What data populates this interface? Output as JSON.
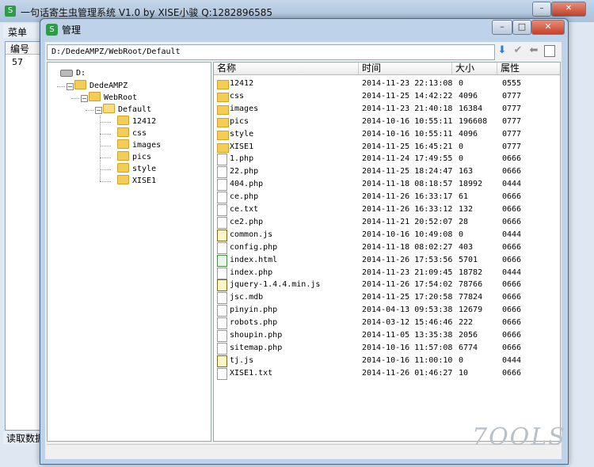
{
  "background_window": {
    "title": "一句话寄生虫管理系统 V1.0 by XISE小骏 Q:1282896585",
    "menu": "菜单",
    "list_header": "编号",
    "list_value": "57",
    "status": "读取数据"
  },
  "window": {
    "title": "管理",
    "min": "–",
    "max": "□",
    "close": "✕"
  },
  "toolbar": {
    "path": "D:/DedeAMPZ/WebRoot/Default",
    "icons": [
      "download-arrow-icon",
      "checkmark-icon",
      "back-arrow-icon",
      "panel-icon"
    ]
  },
  "tree": [
    {
      "label": "D:",
      "type": "drive"
    },
    {
      "label": "DedeAMPZ",
      "type": "folder"
    },
    {
      "label": "WebRoot",
      "type": "folder"
    },
    {
      "label": "Default",
      "type": "folder-open"
    },
    {
      "label": "12412",
      "type": "folder"
    },
    {
      "label": "css",
      "type": "folder"
    },
    {
      "label": "images",
      "type": "folder"
    },
    {
      "label": "pics",
      "type": "folder"
    },
    {
      "label": "style",
      "type": "folder"
    },
    {
      "label": "XISE1",
      "type": "folder"
    }
  ],
  "columns": {
    "name": "名称",
    "time": "时间",
    "size": "大小",
    "attr": "属性"
  },
  "files": [
    {
      "name": "12412",
      "time": "2014-11-23 22:13:08",
      "size": "0",
      "attr": "0555",
      "type": "folder"
    },
    {
      "name": "css",
      "time": "2014-11-25 14:42:22",
      "size": "4096",
      "attr": "0777",
      "type": "folder"
    },
    {
      "name": "images",
      "time": "2014-11-23 21:40:18",
      "size": "16384",
      "attr": "0777",
      "type": "folder"
    },
    {
      "name": "pics",
      "time": "2014-10-16 10:55:11",
      "size": "196608",
      "attr": "0777",
      "type": "folder"
    },
    {
      "name": "style",
      "time": "2014-10-16 10:55:11",
      "size": "4096",
      "attr": "0777",
      "type": "folder"
    },
    {
      "name": "XISE1",
      "time": "2014-11-25 16:45:21",
      "size": "0",
      "attr": "0777",
      "type": "folder"
    },
    {
      "name": "1.php",
      "time": "2014-11-24 17:49:55",
      "size": "0",
      "attr": "0666",
      "type": "file"
    },
    {
      "name": "22.php",
      "time": "2014-11-25 18:24:47",
      "size": "163",
      "attr": "0666",
      "type": "file"
    },
    {
      "name": "404.php",
      "time": "2014-11-18 08:18:57",
      "size": "18992",
      "attr": "0444",
      "type": "file"
    },
    {
      "name": "ce.php",
      "time": "2014-11-26 16:33:17",
      "size": "61",
      "attr": "0666",
      "type": "file"
    },
    {
      "name": "ce.txt",
      "time": "2014-11-26 16:33:12",
      "size": "132",
      "attr": "0666",
      "type": "file"
    },
    {
      "name": "ce2.php",
      "time": "2014-11-21 20:52:07",
      "size": "28",
      "attr": "0666",
      "type": "file"
    },
    {
      "name": "common.js",
      "time": "2014-10-16 10:49:08",
      "size": "0",
      "attr": "0444",
      "type": "js"
    },
    {
      "name": "config.php",
      "time": "2014-11-18 08:02:27",
      "size": "403",
      "attr": "0666",
      "type": "file"
    },
    {
      "name": "index.html",
      "time": "2014-11-26 17:53:56",
      "size": "5701",
      "attr": "0666",
      "type": "html"
    },
    {
      "name": "index.php",
      "time": "2014-11-23 21:09:45",
      "size": "18782",
      "attr": "0444",
      "type": "file"
    },
    {
      "name": "jquery-1.4.4.min.js",
      "time": "2014-11-26 17:54:02",
      "size": "78766",
      "attr": "0666",
      "type": "js"
    },
    {
      "name": "jsc.mdb",
      "time": "2014-11-25 17:20:58",
      "size": "77824",
      "attr": "0666",
      "type": "file"
    },
    {
      "name": "pinyin.php",
      "time": "2014-04-13 09:53:38",
      "size": "12679",
      "attr": "0666",
      "type": "file"
    },
    {
      "name": "robots.php",
      "time": "2014-03-12 15:46:46",
      "size": "222",
      "attr": "0666",
      "type": "file"
    },
    {
      "name": "shoupin.php",
      "time": "2014-11-05 13:35:38",
      "size": "2056",
      "attr": "0666",
      "type": "file"
    },
    {
      "name": "sitemap.php",
      "time": "2014-10-16 11:57:08",
      "size": "6774",
      "attr": "0666",
      "type": "file"
    },
    {
      "name": "tj.js",
      "time": "2014-10-16 11:00:10",
      "size": "0",
      "attr": "0444",
      "type": "js"
    },
    {
      "name": "XISE1.txt",
      "time": "2014-11-26 01:46:27",
      "size": "10",
      "attr": "0666",
      "type": "file"
    }
  ],
  "watermark": "7OOLS"
}
